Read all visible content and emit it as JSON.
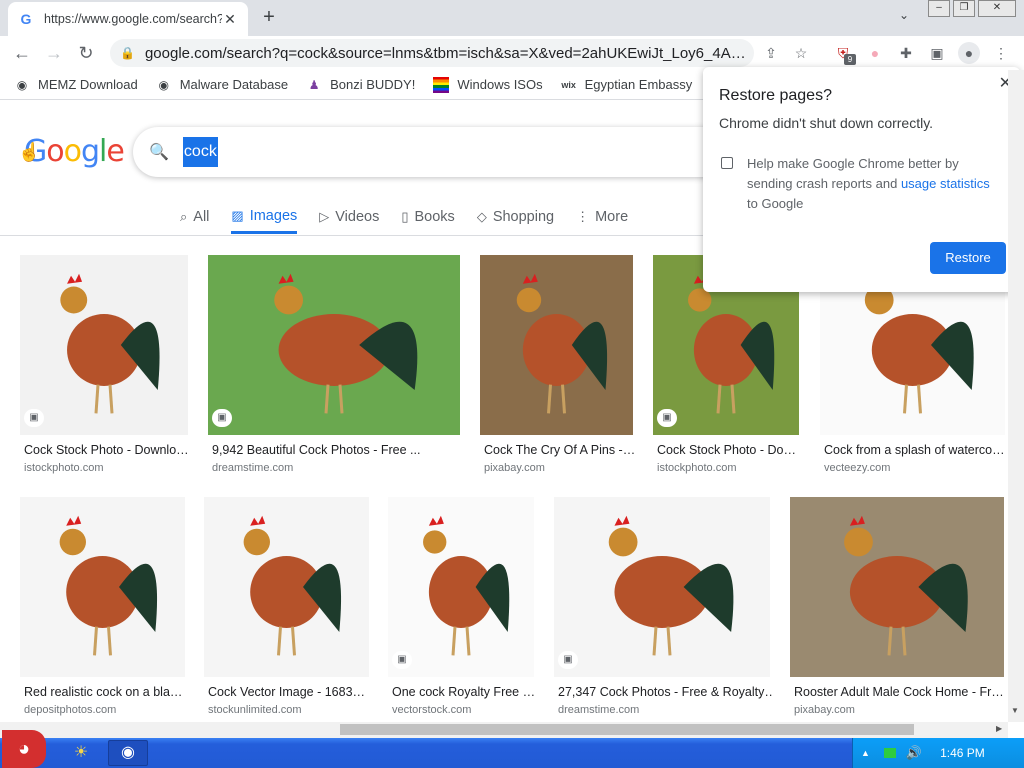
{
  "browser": {
    "tab_title": "https://www.google.com/search?q=cock",
    "tab_favicon": "G",
    "close_tab": "✕",
    "new_tab": "+",
    "tab_search": "⌄",
    "url": "google.com/search?q=cock&source=lnms&tbm=isch&sa=X&ved=2ahUKEwiJt_Loy6_4A…",
    "ext_badge": "9",
    "window_buttons": [
      "–",
      "❐",
      "✕"
    ]
  },
  "bookmarks": [
    {
      "label": "MEMZ Download",
      "icon": "globe-icon"
    },
    {
      "label": "Malware Database",
      "icon": "globe-icon"
    },
    {
      "label": "Bonzi BUDDY!",
      "icon": "bonzi-icon"
    },
    {
      "label": "Windows ISOs",
      "icon": "windows-flag-icon"
    },
    {
      "label": "Egyptian Embassy",
      "icon": "wix-icon"
    }
  ],
  "google": {
    "logo": [
      "G",
      "o",
      "o",
      "g",
      "l",
      "e"
    ],
    "logo_colors": [
      "#4285f4",
      "#ea4335",
      "#fbbc05",
      "#4285f4",
      "#34a853",
      "#ea4335"
    ],
    "query": "cock",
    "tabs": [
      {
        "label": "All",
        "icon": "search-icon"
      },
      {
        "label": "Images",
        "icon": "image-icon",
        "active": true
      },
      {
        "label": "Videos",
        "icon": "play-icon"
      },
      {
        "label": "Books",
        "icon": "book-icon"
      },
      {
        "label": "Shopping",
        "icon": "tag-icon"
      },
      {
        "label": "More",
        "icon": "more-vert-icon"
      }
    ]
  },
  "results": [
    {
      "title": "Cock Stock Photo - Downlo…",
      "source": "istockphoto.com",
      "bg": "#f2f2f2",
      "badge": true
    },
    {
      "title": "9,942 Beautiful Cock Photos - Free ...",
      "source": "dreamstime.com",
      "bg": "#6aa84f",
      "badge": true
    },
    {
      "title": "Cock The Cry Of A Pins -…",
      "source": "pixabay.com",
      "bg": "#8a6d4a",
      "badge": false
    },
    {
      "title": "Cock Stock Photo - Do…",
      "source": "istockphoto.com",
      "bg": "#7a9a40",
      "badge": true
    },
    {
      "title": "Cock from a splash of waterco…",
      "source": "vecteezy.com",
      "bg": "#fafafa",
      "badge": false
    },
    {
      "title": "Red realistic cock on a bla…",
      "source": "depositphotos.com",
      "bg": "#f5f5f5",
      "badge": false
    },
    {
      "title": "Cock Vector Image - 1683…",
      "source": "stockunlimited.com",
      "bg": "#f5f5f5",
      "badge": false
    },
    {
      "title": "One cock Royalty Free …",
      "source": "vectorstock.com",
      "bg": "#fafafa",
      "badge": true
    },
    {
      "title": "27,347 Cock Photos - Free & Royalty…",
      "source": "dreamstime.com",
      "bg": "#f5f5f5",
      "badge": true
    },
    {
      "title": "Rooster Adult Male Cock Home - Fr…",
      "source": "pixabay.com",
      "bg": "#9a8a70",
      "badge": false
    }
  ],
  "restore_popup": {
    "title": "Restore pages?",
    "message": "Chrome didn't shut down correctly.",
    "checkbox_text_1": "Help make Google Chrome better by sending crash reports and ",
    "checkbox_link": "usage statistics",
    "checkbox_text_2": " to Google",
    "button": "Restore",
    "close": "✕"
  },
  "taskbar": {
    "clock": "1:46 PM"
  }
}
